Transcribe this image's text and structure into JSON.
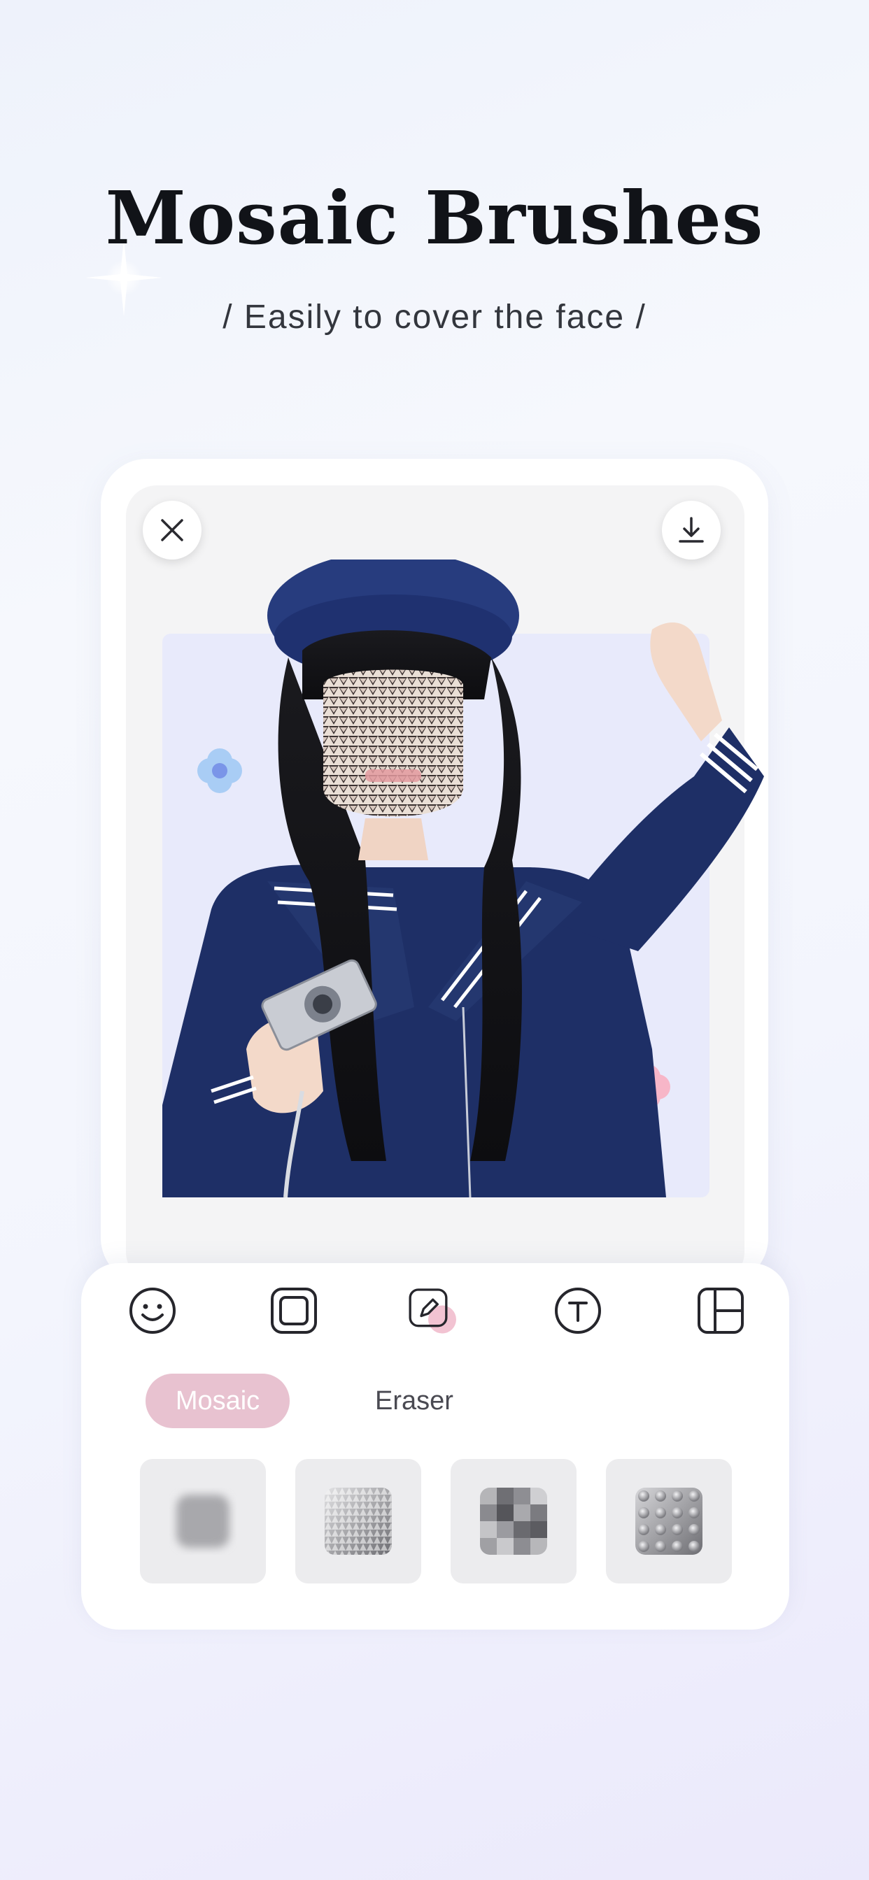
{
  "hero": {
    "title": "Mosaic Brushes",
    "subtitle": "/ Easily to cover the face /"
  },
  "editor": {
    "close_icon": "close-icon",
    "download_icon": "download-icon",
    "photo_description_icon": "photo"
  },
  "toolbar": {
    "tools": [
      {
        "icon": "sticker-smiley-icon"
      },
      {
        "icon": "frame-icon"
      },
      {
        "icon": "brush-pencil-icon",
        "active": true
      },
      {
        "icon": "text-icon"
      },
      {
        "icon": "layout-icon"
      }
    ],
    "tabs": {
      "mosaic": "Mosaic",
      "eraser": "Eraser"
    },
    "brushes": [
      {
        "icon": "blur-brush-icon"
      },
      {
        "icon": "gradient-dots-brush-icon"
      },
      {
        "icon": "pixel-brush-icon"
      },
      {
        "icon": "lego-brush-icon"
      }
    ]
  },
  "colors": {
    "accent_pink": "#e8c2d0",
    "photo_bg": "#e8eafb",
    "uniform_navy": "#1e2f66"
  }
}
